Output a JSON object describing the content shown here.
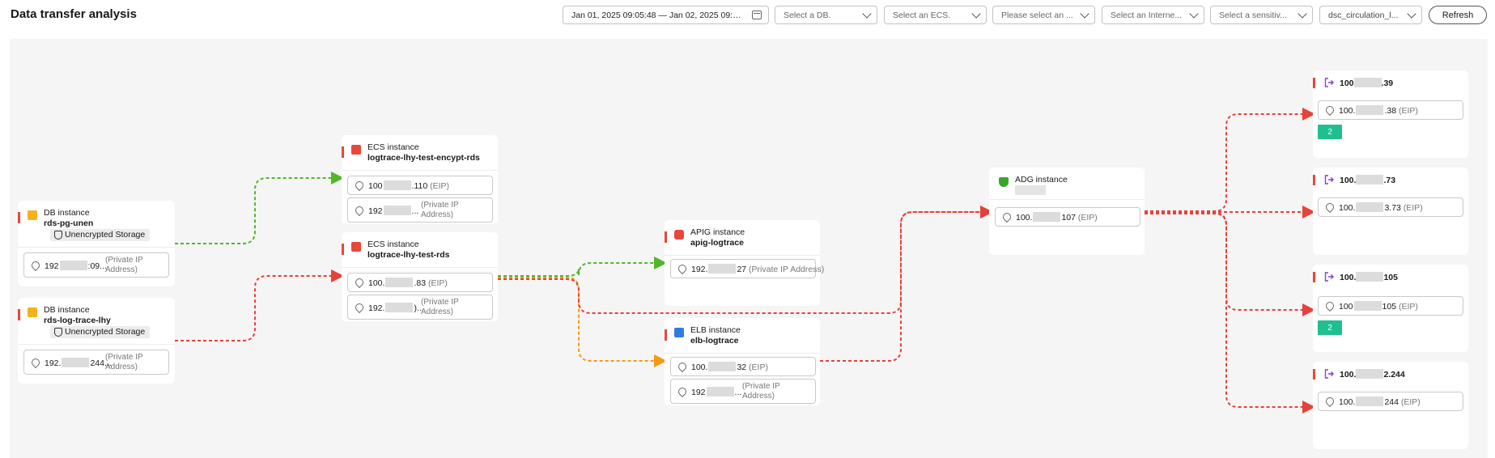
{
  "header": {
    "title": "Data transfer analysis",
    "date_range": "Jan 01, 2025 09:05:48 — Jan 02, 2025 09:05:48",
    "filters": {
      "db": "Select a DB.",
      "ecs": "Select an ECS.",
      "other": "Please select an ...",
      "internet": "Select an Interne...",
      "sensitive": "Select a sensitiv...",
      "circulation": "dsc_circulation_l..."
    },
    "refresh_label": "Refresh"
  },
  "nodes": {
    "db1": {
      "type": "DB instance",
      "name": "rds-pg-unen",
      "badge": "Unencrypted Storage",
      "ip_prefix": "192",
      "ip_suffix": ":09...",
      "ip_kind": "(Private IP Address)"
    },
    "db2": {
      "type": "DB instance",
      "name": "rds-log-trace-lhy",
      "badge": "Unencrypted Storage",
      "ip_prefix": "192.",
      "ip_suffix": "244...",
      "ip_kind": "(Private IP Address)"
    },
    "ecs1": {
      "type": "ECS instance",
      "name": "logtrace-lhy-test-encypt-rds",
      "eip_prefix": "100",
      "eip_suffix": ".110",
      "eip_kind": "(EIP)",
      "pip_prefix": "192",
      "pip_suffix": "...",
      "pip_kind": "(Private IP Address)"
    },
    "ecs2": {
      "type": "ECS instance",
      "name": "logtrace-lhy-test-rds",
      "eip_prefix": "100.",
      "eip_suffix": ".83",
      "eip_kind": "(EIP)",
      "pip_prefix": "192.",
      "pip_suffix": ")...",
      "pip_kind": "(Private IP Address)"
    },
    "apig": {
      "type": "APIG instance",
      "name": "apig-logtrace",
      "ip_prefix": "192.",
      "ip_suffix": "27",
      "ip_kind": "(Private IP Address)"
    },
    "elb": {
      "type": "ELB instance",
      "name": "elb-logtrace",
      "eip_prefix": "100.",
      "eip_suffix": "32",
      "eip_kind": "(EIP)",
      "pip_prefix": "192",
      "pip_suffix": "...",
      "pip_kind": "(Private IP Address)"
    },
    "adg": {
      "type": "ADG instance",
      "eip_prefix": "100.",
      "eip_suffix": "107",
      "eip_kind": "(EIP)"
    }
  },
  "externals": [
    {
      "title_prefix": "100",
      "title_suffix": ".39",
      "ip_prefix": "100.",
      "ip_suffix": ".38",
      "ip_kind": "(EIP)",
      "count": "2"
    },
    {
      "title_prefix": "100.",
      "title_suffix": ".73",
      "ip_prefix": "100.",
      "ip_suffix": "3.73",
      "ip_kind": "(EIP)"
    },
    {
      "title_prefix": "100.",
      "title_suffix": "105",
      "ip_prefix": "100",
      "ip_suffix": "105",
      "ip_kind": "(EIP)",
      "count": "2"
    },
    {
      "title_prefix": "100.",
      "title_suffix": "2.244",
      "ip_prefix": "100.",
      "ip_suffix": "244",
      "ip_kind": "(EIP)"
    }
  ],
  "colors": {
    "green": "#52b62a",
    "red": "#e8403a",
    "orange": "#f39b14",
    "teal": "#1fbf8f"
  }
}
